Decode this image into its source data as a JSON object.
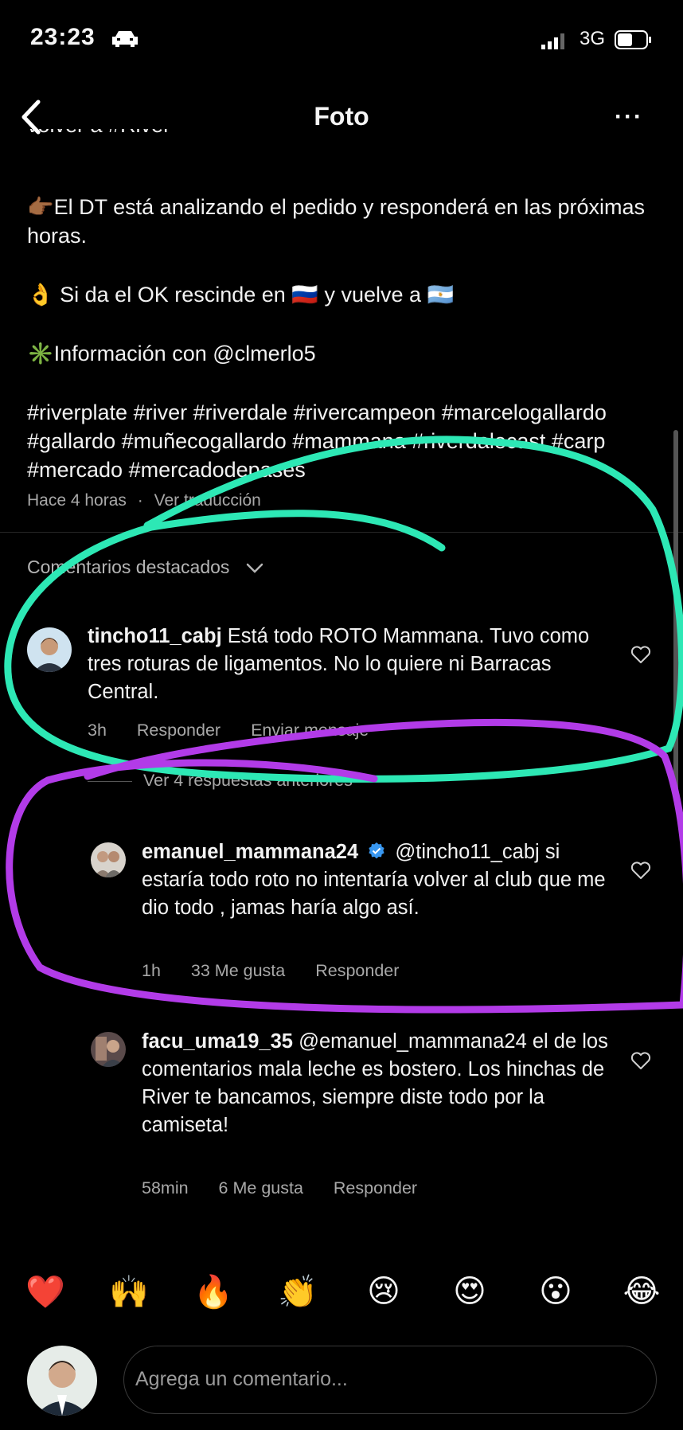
{
  "status": {
    "time": "23:23",
    "network": "3G"
  },
  "nav": {
    "title": "Foto",
    "more": "···"
  },
  "caption": {
    "cut_line": "volver a #River",
    "line1_emoji": "👉🏾",
    "line1": "El DT está analizando el pedido y responderá en las próximas horas.",
    "line2_emoji": "👌",
    "line2a": "Si da el OK rescinde en",
    "flag_ru": "🇷🇺",
    "line2b": "y vuelve a",
    "flag_ar": "🇦🇷",
    "line3_emoji": "✳️",
    "line3": "Información con @clmerlo5",
    "hashtags": "#riverplate #river #riverdale #rivercampeon #marcelogallardo #gallardo #muñecogallardo #mammana #riverdalecast #carp #mercado #mercadodepases",
    "time_ago": "Hace 4 horas",
    "dot": "·",
    "see_translation": "Ver traducción"
  },
  "featured_label": "Comentarios destacados",
  "comments": [
    {
      "user": "tincho11_cabj",
      "text": "Está todo ROTO Mammana. Tuvo como tres roturas de ligamentos. No lo quiere ni Barracas Central.",
      "time": "3h",
      "reply": "Responder",
      "send": "Enviar mensaje"
    }
  ],
  "view_replies": "Ver 4 respuestas anteriores",
  "replies": [
    {
      "user": "emanuel_mammana24",
      "verified": true,
      "mention": "@tincho11_cabj",
      "text": "si estaría todo roto no intentaría volver al club que me dio todo , jamas haría algo así.",
      "time": "1h",
      "likes": "33 Me gusta",
      "reply": "Responder"
    },
    {
      "user": "facu_uma19_35",
      "mention": "@emanuel_mammana24",
      "text": "el de los comentarios mala leche es bostero. Los hinchas de River te bancamos, siempre diste todo por la camiseta!",
      "time": "58min",
      "likes": "6 Me gusta",
      "reply": "Responder"
    }
  ],
  "emoji_bar": [
    "❤️",
    "🙌",
    "🔥",
    "👏",
    "😢",
    "😍",
    "😮",
    "😂"
  ],
  "comment_input": {
    "placeholder": "Agrega un comentario..."
  },
  "colors": {
    "annotation_green": "#2de8b5",
    "annotation_purple": "#b23be8"
  }
}
